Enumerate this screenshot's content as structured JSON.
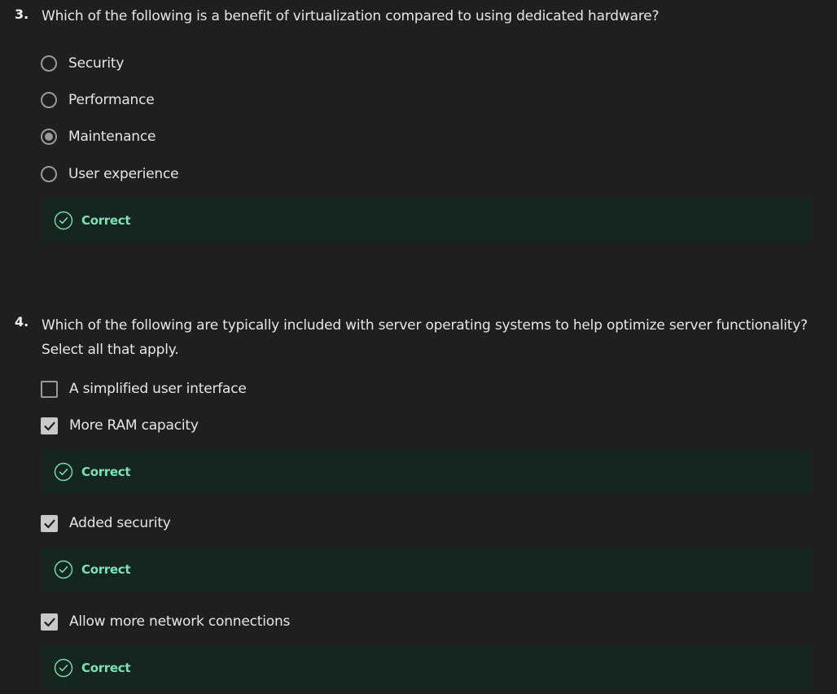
{
  "questions": [
    {
      "number": "3.",
      "text": "Which of the following is a benefit of virtualization compared to using dedicated hardware?",
      "type": "radio",
      "options": [
        {
          "label": "Security",
          "checked": false
        },
        {
          "label": "Performance",
          "checked": false
        },
        {
          "label": "Maintenance",
          "checked": true
        },
        {
          "label": "User experience",
          "checked": false
        }
      ],
      "feedback": "Correct"
    },
    {
      "number": "4.",
      "text_line1": "Which of the following are typically included with server operating systems to help optimize server functionality?",
      "text_line2": "Select all that apply.",
      "type": "checkbox",
      "options": [
        {
          "label": "A simplified user interface",
          "checked": false
        },
        {
          "label": "More RAM capacity",
          "checked": true,
          "feedback": "Correct"
        },
        {
          "label": "Added security",
          "checked": true,
          "feedback": "Correct"
        },
        {
          "label": "Allow more network connections",
          "checked": true,
          "feedback": "Correct"
        }
      ]
    }
  ],
  "colors": {
    "background": "#1f1f1f",
    "feedback_bg": "#15251f",
    "correct_text": "#7fe0b5",
    "control_border": "#9a9a9a"
  },
  "icons": {
    "feedback": "check-circle-icon",
    "checkbox_checked": "checkmark-icon"
  }
}
